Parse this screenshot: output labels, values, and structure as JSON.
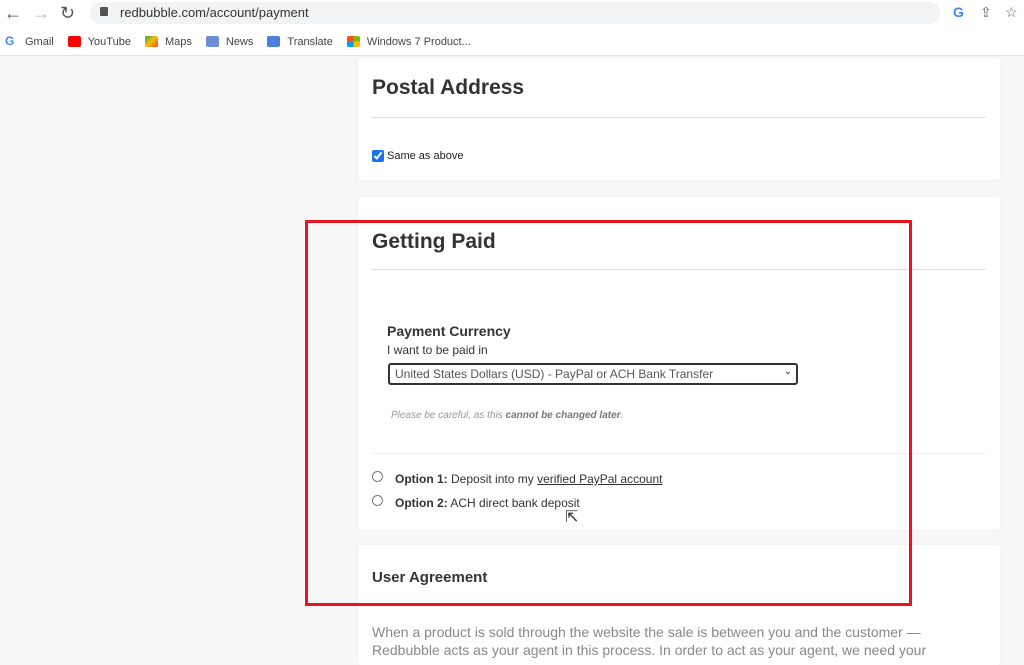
{
  "browser": {
    "url": "redbubble.com/account/payment",
    "bookmarks": [
      {
        "label": "Gmail",
        "icon": "google-icon"
      },
      {
        "label": "YouTube",
        "icon": "youtube-icon"
      },
      {
        "label": "Maps",
        "icon": "maps-icon"
      },
      {
        "label": "News",
        "icon": "news-icon"
      },
      {
        "label": "Translate",
        "icon": "translate-icon"
      },
      {
        "label": "Windows 7 Product...",
        "icon": "windows-icon"
      }
    ]
  },
  "postal": {
    "title": "Postal Address",
    "same_label": "Same as above",
    "same_checked": true
  },
  "getting_paid": {
    "title": "Getting Paid",
    "currency_title": "Payment Currency",
    "currency_label": "I want to be paid in",
    "currency_value": "United States Dollars (USD) - PayPal or ACH Bank Transfer",
    "warning_prefix": "Please be careful, as this ",
    "warning_bold": "cannot be changed later",
    "warning_suffix": ".",
    "option1_label": "Option 1:",
    "option1_text": "Deposit into my ",
    "option1_link": "verified PayPal account",
    "option2_label": "Option 2:",
    "option2_text": "ACH direct bank deposit"
  },
  "agreement": {
    "title": "User Agreement",
    "text": "When a product is sold through the website the sale is between you and the customer — Redbubble acts as your agent in this process. In order to act as your agent, we need your"
  },
  "colors": {
    "highlight": "#e8141e",
    "checkbox": "#1a73e8"
  }
}
